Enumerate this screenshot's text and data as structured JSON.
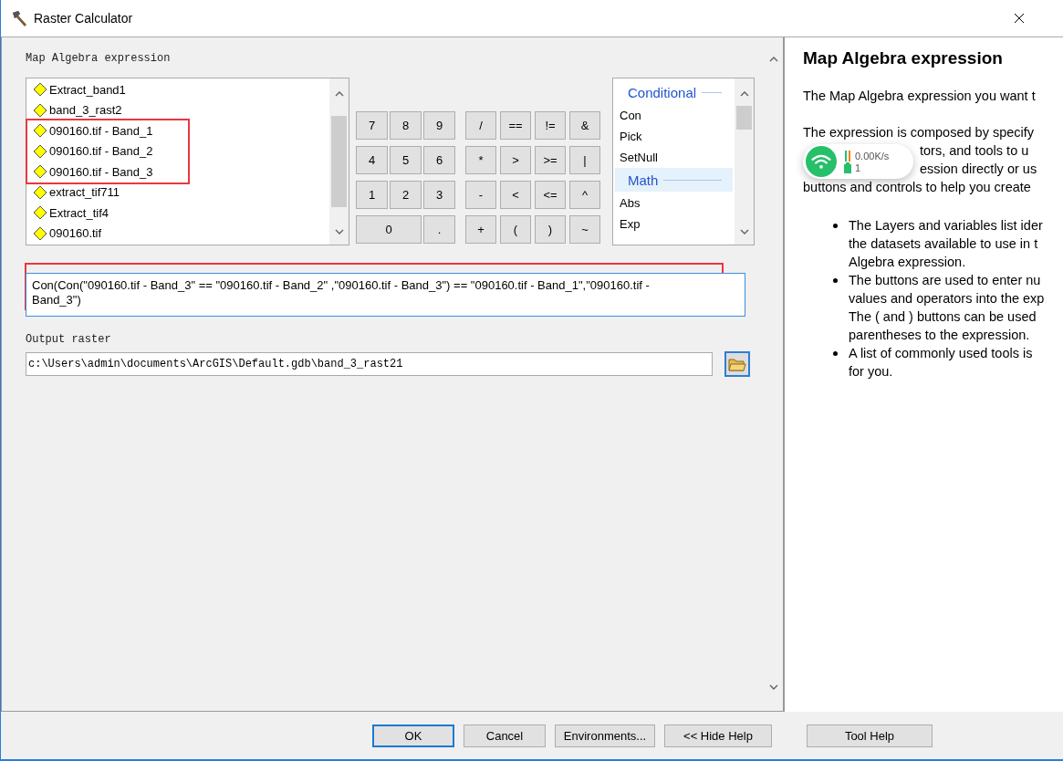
{
  "window": {
    "title": "Raster Calculator"
  },
  "expression_label": "Map Algebra expression",
  "layer_groups": [
    {
      "boxed": false,
      "items": [
        "Extract_band1",
        "band_3_rast2"
      ]
    },
    {
      "boxed": true,
      "items": [
        "090160.tif - Band_1",
        "090160.tif - Band_2",
        "090160.tif - Band_3"
      ]
    },
    {
      "boxed": false,
      "items": [
        "extract_tif711",
        "Extract_tif4",
        "090160.tif"
      ]
    }
  ],
  "number_keys": [
    {
      "label": "7",
      "kind": "normal"
    },
    {
      "label": "8",
      "kind": "normal"
    },
    {
      "label": "9",
      "kind": "normal"
    },
    {
      "label": "4",
      "kind": "normal"
    },
    {
      "label": "5",
      "kind": "normal"
    },
    {
      "label": "6",
      "kind": "normal"
    },
    {
      "label": "1",
      "kind": "normal"
    },
    {
      "label": "2",
      "kind": "normal"
    },
    {
      "label": "3",
      "kind": "normal"
    },
    {
      "label": "0",
      "kind": "wide"
    },
    {
      "label": ".",
      "kind": "normal"
    }
  ],
  "operator_keys": [
    "/",
    "==",
    "!=",
    "&",
    "*",
    ">",
    ">=",
    "|",
    "-",
    "<",
    "<=",
    "^",
    "+",
    "(",
    ")",
    "~"
  ],
  "functions": [
    {
      "label": "Conditional",
      "kind": "heading",
      "selected": false
    },
    {
      "label": "Con",
      "kind": "function",
      "selected": false
    },
    {
      "label": "Pick",
      "kind": "function",
      "selected": false
    },
    {
      "label": "SetNull",
      "kind": "function",
      "selected": false
    },
    {
      "label": "Math",
      "kind": "heading",
      "selected": true
    },
    {
      "label": "Abs",
      "kind": "function",
      "selected": false
    },
    {
      "label": "Exp",
      "kind": "function",
      "selected": false
    }
  ],
  "expression": {
    "value": "Con(Con(\"090160.tif - Band_3\" == \"090160.tif - Band_2\" ,\"090160.tif - Band_3\") == \"090160.tif - Band_1\",\"090160.tif - Band_3\")",
    "boxed": true
  },
  "output_label": "Output raster",
  "output_value": "c:\\Users\\admin\\documents\\ArcGIS\\Default.gdb\\band_3_rast21",
  "help": {
    "title": "Map Algebra expression",
    "intro": "The Map Algebra expression you want t",
    "lines": [
      {
        "text": "The expression is composed by specify",
        "kind": "full"
      },
      {
        "text": "tors, and tools to u",
        "kind": "partial"
      },
      {
        "text": "ession directly or us",
        "kind": "partial"
      },
      {
        "text": "buttons and controls to help you create",
        "kind": "full"
      }
    ],
    "bullets": [
      [
        "The Layers and variables list ider",
        "the datasets available to use in t",
        "Algebra expression."
      ],
      [
        "The buttons are used to enter nu",
        "values and operators into the exp",
        "The ( and ) buttons can be used",
        "parentheses to the expression."
      ],
      [
        "A list of commonly used tools is",
        "for you."
      ]
    ]
  },
  "network_widget": {
    "speed": "0.00K/s",
    "count": "1"
  },
  "buttons": [
    {
      "label": "OK",
      "selected": true
    },
    {
      "label": "Cancel",
      "selected": false
    },
    {
      "label": "Environments...",
      "selected": false
    },
    {
      "label": "<< Hide Help",
      "selected": false
    },
    {
      "label": "Tool Help",
      "selected": false
    }
  ]
}
